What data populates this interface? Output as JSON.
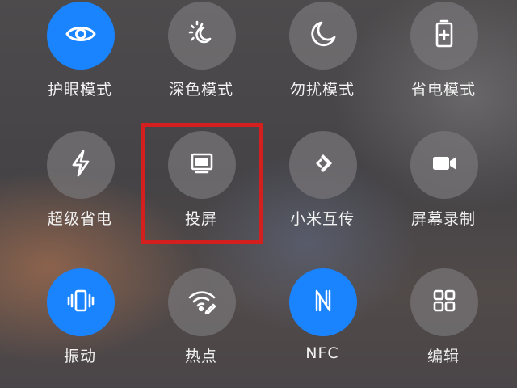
{
  "tiles": [
    {
      "label": "护眼模式",
      "icon": "eye-icon",
      "active": true
    },
    {
      "label": "深色模式",
      "icon": "sun-moon-icon",
      "active": false
    },
    {
      "label": "勿扰模式",
      "icon": "moon-icon",
      "active": false
    },
    {
      "label": "省电模式",
      "icon": "battery-plus-icon",
      "active": false
    },
    {
      "label": "超级省电",
      "icon": "lightning-icon",
      "active": false
    },
    {
      "label": "投屏",
      "icon": "monitor-icon",
      "active": false
    },
    {
      "label": "小米互传",
      "icon": "mi-share-icon",
      "active": false
    },
    {
      "label": "屏幕录制",
      "icon": "video-camera-icon",
      "active": false
    },
    {
      "label": "振动",
      "icon": "vibrate-phone-icon",
      "active": true
    },
    {
      "label": "热点",
      "icon": "hotspot-wifi-icon",
      "active": false
    },
    {
      "label": "NFC",
      "icon": "nfc-icon",
      "active": true
    },
    {
      "label": "编辑",
      "icon": "grid-icon",
      "active": false
    }
  ],
  "colors": {
    "active": "#1a84ff",
    "inactive": "#787678",
    "highlight_box": "#d41f1f"
  }
}
